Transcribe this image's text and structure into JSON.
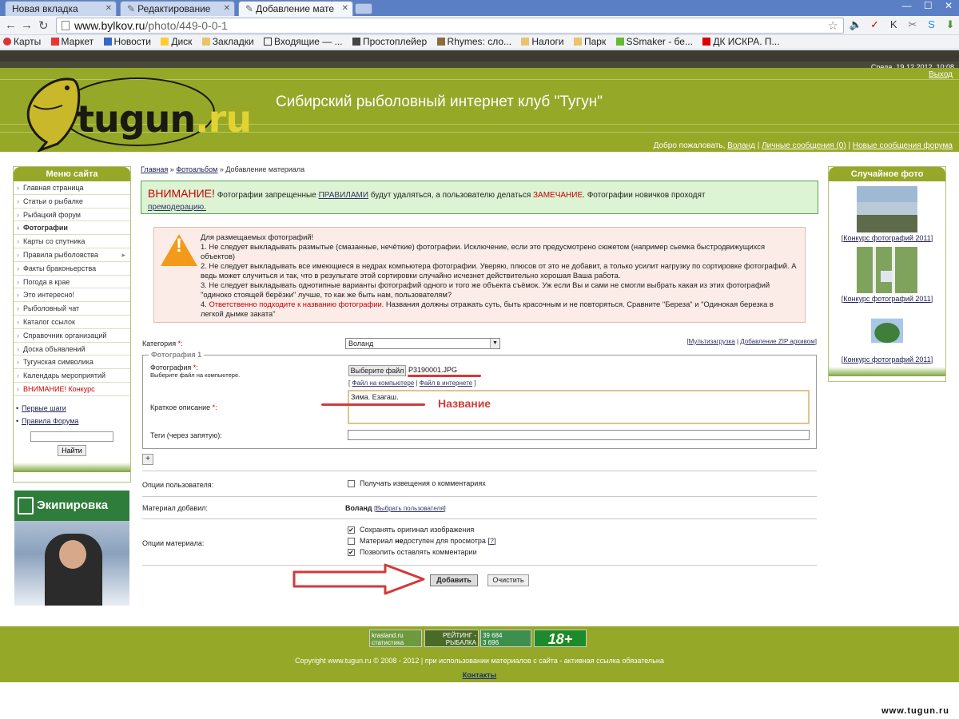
{
  "browser": {
    "tabs": [
      {
        "label": "Новая вкладка"
      },
      {
        "label": "Редактирование"
      },
      {
        "label": "Добавление мате"
      }
    ],
    "address": {
      "host": "www.bylkov.ru",
      "path": "/photo/449-0-0-1"
    },
    "bookmarks": [
      {
        "label": "Карты"
      },
      {
        "label": "Маркет"
      },
      {
        "label": "Новости"
      },
      {
        "label": "Диск"
      },
      {
        "label": "Закладки"
      },
      {
        "label": "Входящие — ..."
      },
      {
        "label": "Простоплейер"
      },
      {
        "label": "Rhymes: сло..."
      },
      {
        "label": "Налоги"
      },
      {
        "label": "Парк"
      },
      {
        "label": "SSmaker - бе..."
      },
      {
        "label": "ДК ИСКРА. П..."
      }
    ]
  },
  "site": {
    "date": "Среда, 19.12.2012, 10:08",
    "logo_main": "tugun",
    "logo_tld": ".ru",
    "title": "Сибирский рыболовный интернет клуб \"Тугун\"",
    "logout": "Выход",
    "welcome_prefix": "Добро пожаловать,",
    "user": "Воланд",
    "messages": "Личные сообщения (0)",
    "forum_messages": "Новые сообщения форума",
    "sep": "|"
  },
  "menu": {
    "title": "Меню сайта",
    "items": [
      "Главная страница",
      "Статьи о рыбалке",
      "Рыбацкий форум",
      "Фотографии",
      "Карты со спутника",
      "Правила рыболовства",
      "Факты браконьерства",
      "Погода в крае",
      "Это интересно!",
      "Рыболовный чат",
      "Каталог ссылок",
      "Справочник организаций",
      "Доска объявлений",
      "Тугунская символика",
      "Календарь мероприятий",
      "ВНИМАНИЕ! Конкурс"
    ],
    "links": [
      "Первые шаги",
      "Правила Форума"
    ],
    "search_button": "Найти"
  },
  "ad": {
    "title": "Экипировка"
  },
  "random_photo": {
    "title": "Случайное фото",
    "caption": "Конкурс фотографий 2011"
  },
  "breadcrumb": {
    "home": "Главная",
    "album": "Фотоальбом",
    "current": "Добавление материала",
    "sep": "»"
  },
  "notice": {
    "title": "ВНИМАНИЕ!",
    "t1": "Фотографии запрещенные",
    "rules_link": "ПРАВИЛАМИ",
    "t2": "будут удаляться, а пользователю делаться",
    "remark": "ЗАМЕЧАНИЕ",
    "t3": ". Фотографии новичков проходят",
    "moderation": "премодерацию."
  },
  "rules": {
    "intro": "Для размещаемых фотографий!",
    "r1": "1. Не следует выкладывать размытые (смазанные, нечёткие) фотографии. Исключение, если это предусмотрено сюжетом (например сьемка быстродвижущихся объектов)",
    "r2": "2. Не следует выкладывать все имеющиеся в недрах компьютера фотографии. Уверяю, плюсов от это не добавит, а только усилит нагрузку по сортировке фотографий. А ведь может случиться и так, что в результате этой сортировки случайно исчезнет действительно хорошая Ваша работа.",
    "r3": "3. Не следует выкладывать однотипные варианты фотографий одного и того же объекта съёмок. Уж если Вы и сами не смогли выбрать какая из этих фотографий \"одиноко стоящей берёзки\" лучше, то как же быть нам, пользователям?",
    "r4_num": "4.",
    "r4_red": "Ответственно подходите к названию фотографии.",
    "r4_rest": "Названия должны отражать суть, быть красочным и не повторяться. Сравните \"Береза\" и \"Одинокая березка в легкой дымке заката\""
  },
  "form": {
    "category_label": "Категория",
    "required": "*:",
    "category_value": "Воланд",
    "multi_upload": "Мультизагрузка",
    "zip_upload": "Добавление ZIP архивом",
    "fieldset_legend": "Фотография 1",
    "photo_label": "Фотография",
    "photo_hint": "Выберите файл на компьютере.",
    "file_button": "Выберите файл",
    "file_name": "P3190001.JPG",
    "file_local": "Файл на компьютере",
    "file_web": "Файл в интернете",
    "desc_label": "Краткое описание",
    "desc_value": "Зима. Езагаш.",
    "tags_label": "Теги (через запятую):",
    "plus": "+",
    "user_options_label": "Опции пользователя:",
    "notify_label": "Получать извещения о комментариях",
    "added_by_label": "Материал добавил:",
    "added_by_user": "Воланд",
    "choose_user": "Выбрать пользователя",
    "material_options_label": "Опции материала:",
    "opt_keep_original": "Сохранять оригинал изображения",
    "opt_unavailable_1": "Материал ",
    "opt_unavailable_bold": "не",
    "opt_unavailable_2": "доступен для просмотра [",
    "opt_unavailable_q": "?",
    "opt_unavailable_3": "]",
    "opt_comments": "Позволить оставлять комментарии",
    "submit": "Добавить",
    "reset": "Очистить",
    "annotation": "Название"
  },
  "footer": {
    "counter1": "krasland.ru статистика",
    "counter2_l1": "РЕЙТИНГ - РЫБАЛКА",
    "counter2_l2": "478",
    "counter2_l3": "2057",
    "counter3_l1": "39 684",
    "counter3_l2": "3 696",
    "counter3_l3": "471",
    "age": "18+",
    "copyright": "Copyright www.tugun.ru © 2008 - 2012 | при использовании материалов с сайта - активная ссылка обязательна",
    "contacts": "Контакты",
    "watermark": "www.tugun.ru"
  }
}
